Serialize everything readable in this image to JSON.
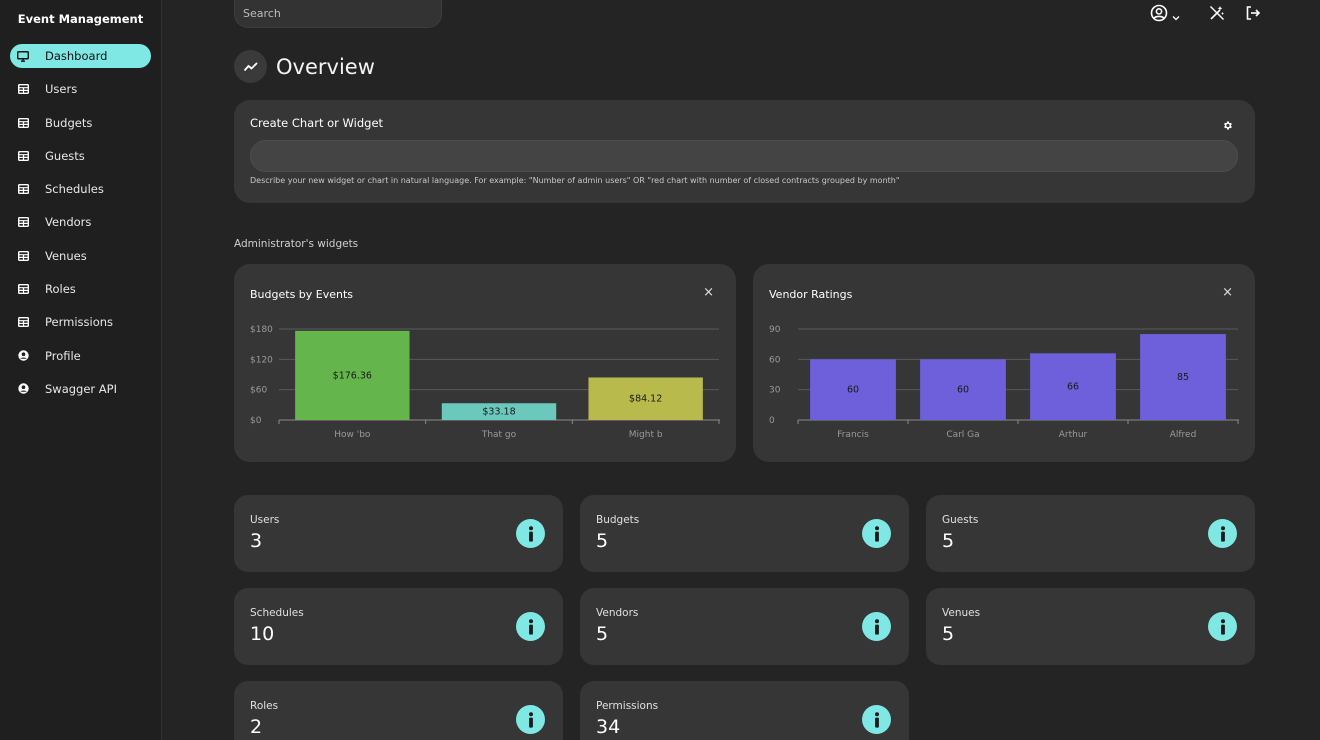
{
  "app": {
    "title": "Event Management"
  },
  "sidebar": {
    "items": [
      {
        "label": "Dashboard",
        "icon": "monitor-icon",
        "active": true
      },
      {
        "label": "Users",
        "icon": "table-icon"
      },
      {
        "label": "Budgets",
        "icon": "table-icon"
      },
      {
        "label": "Guests",
        "icon": "table-icon"
      },
      {
        "label": "Schedules",
        "icon": "table-icon"
      },
      {
        "label": "Vendors",
        "icon": "table-icon"
      },
      {
        "label": "Venues",
        "icon": "table-icon"
      },
      {
        "label": "Roles",
        "icon": "table-icon"
      },
      {
        "label": "Permissions",
        "icon": "table-icon"
      },
      {
        "label": "Profile",
        "icon": "user-circle-icon"
      },
      {
        "label": "Swagger API",
        "icon": "user-circle-icon"
      }
    ]
  },
  "search": {
    "placeholder": "Search"
  },
  "header": {
    "title": "Overview"
  },
  "create_widget": {
    "title": "Create Chart or Widget",
    "input_value": "",
    "hint": "Describe your new widget or chart in natural language. For example: \"Number of admin users\" OR \"red chart with number of closed contracts grouped by month\""
  },
  "widgets_section": {
    "label": "Administrator's widgets"
  },
  "colors": {
    "accent": "#7fe8e4",
    "bar_green": "#64b54b",
    "bar_teal": "#6ac8bc",
    "bar_olive": "#b8ba4c",
    "bar_purple": "#6e5fda"
  },
  "chart_data": [
    {
      "type": "bar",
      "title": "Budgets by Events",
      "categories": [
        "How 'bo",
        "That go",
        "Might b"
      ],
      "values": [
        176.36,
        33.18,
        84.12
      ],
      "value_labels": [
        "$176.36",
        "$33.18",
        "$84.12"
      ],
      "bar_colors": [
        "#64b54b",
        "#6ac8bc",
        "#b8ba4c"
      ],
      "yticks": [
        "$0",
        "$60",
        "$120",
        "$180"
      ],
      "ylim": [
        0,
        180
      ],
      "grid": true,
      "close_label": "×"
    },
    {
      "type": "bar",
      "title": "Vendor Ratings",
      "categories": [
        "Francis",
        "Carl Ga",
        "Arthur",
        "Alfred"
      ],
      "values": [
        60,
        60,
        66,
        85
      ],
      "value_labels": [
        "60",
        "60",
        "66",
        "85"
      ],
      "bar_colors": [
        "#6e5fda",
        "#6e5fda",
        "#6e5fda",
        "#6e5fda"
      ],
      "yticks": [
        "0",
        "30",
        "60",
        "90"
      ],
      "ylim": [
        0,
        90
      ],
      "grid": true,
      "close_label": "×"
    }
  ],
  "stats": [
    {
      "label": "Users",
      "value": "3"
    },
    {
      "label": "Budgets",
      "value": "5"
    },
    {
      "label": "Guests",
      "value": "5"
    },
    {
      "label": "Schedules",
      "value": "10"
    },
    {
      "label": "Vendors",
      "value": "5"
    },
    {
      "label": "Venues",
      "value": "5"
    },
    {
      "label": "Roles",
      "value": "2"
    },
    {
      "label": "Permissions",
      "value": "34"
    }
  ]
}
